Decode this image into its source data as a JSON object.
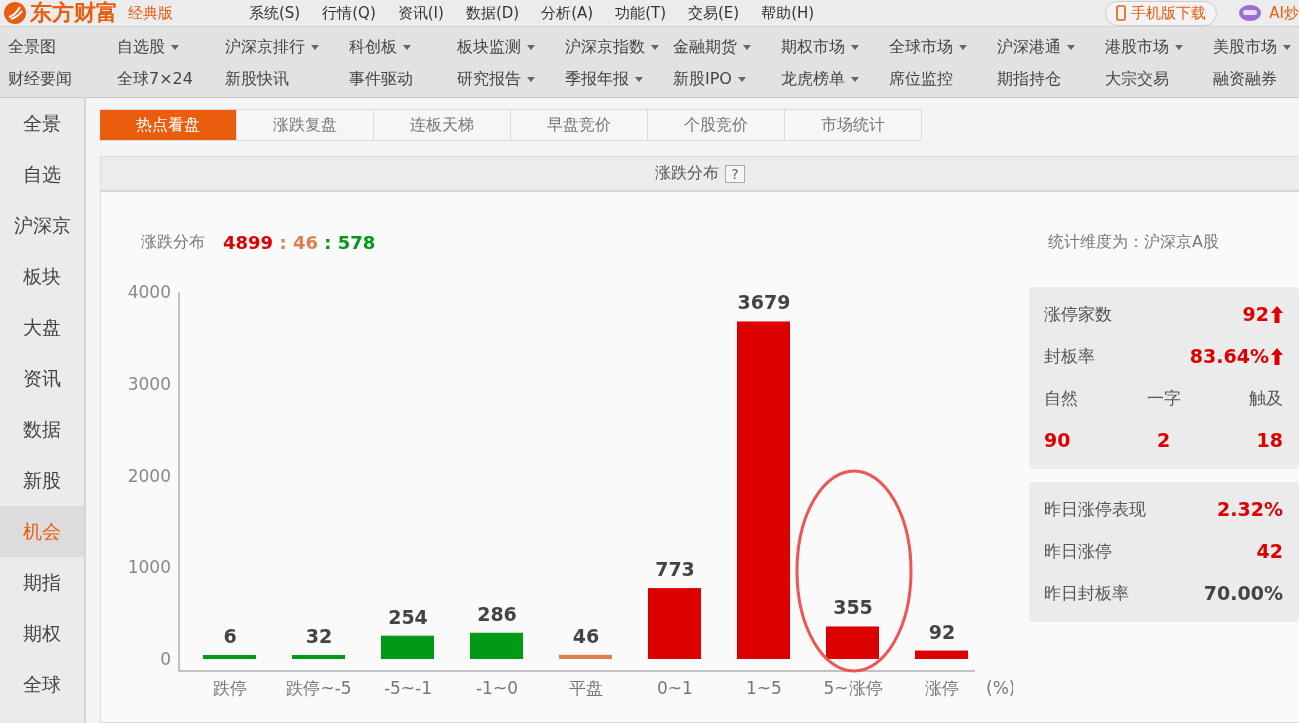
{
  "app_bar": {
    "logo": "东方财富",
    "edition": "经典版",
    "menu": [
      "系统(S)",
      "行情(Q)",
      "资讯(I)",
      "数据(D)",
      "分析(A)",
      "功能(T)",
      "交易(E)",
      "帮助(H)"
    ],
    "mobile_button": "手机版下载",
    "ai_link": "AI炒"
  },
  "nav_rows": [
    [
      {
        "label": "全景图",
        "dropdown": false
      },
      {
        "label": "自选股",
        "dropdown": true
      },
      {
        "label": "沪深京排行",
        "dropdown": true
      },
      {
        "label": "科创板",
        "dropdown": true
      },
      {
        "label": "板块监测",
        "dropdown": true
      },
      {
        "label": "沪深京指数",
        "dropdown": true
      },
      {
        "label": "金融期货",
        "dropdown": true
      },
      {
        "label": "期权市场",
        "dropdown": true
      },
      {
        "label": "全球市场",
        "dropdown": true
      },
      {
        "label": "沪深港通",
        "dropdown": true
      },
      {
        "label": "港股市场",
        "dropdown": true
      },
      {
        "label": "美股市场",
        "dropdown": true
      }
    ],
    [
      {
        "label": "财经要闻",
        "dropdown": false
      },
      {
        "label": "全球7×24",
        "dropdown": false
      },
      {
        "label": "新股快讯",
        "dropdown": false
      },
      {
        "label": "事件驱动",
        "dropdown": false
      },
      {
        "label": "研究报告",
        "dropdown": true
      },
      {
        "label": "季报年报",
        "dropdown": true
      },
      {
        "label": "新股IPO",
        "dropdown": true
      },
      {
        "label": "龙虎榜单",
        "dropdown": true
      },
      {
        "label": "席位监控",
        "dropdown": false
      },
      {
        "label": "期指持仓",
        "dropdown": false
      },
      {
        "label": "大宗交易",
        "dropdown": false
      },
      {
        "label": "融资融券",
        "dropdown": false
      }
    ]
  ],
  "sidebar": {
    "items": [
      {
        "label": "全景",
        "selected": false
      },
      {
        "label": "自选",
        "selected": false
      },
      {
        "label": "沪深京",
        "selected": false
      },
      {
        "label": "板块",
        "selected": false
      },
      {
        "label": "大盘",
        "selected": false
      },
      {
        "label": "资讯",
        "selected": false
      },
      {
        "label": "数据",
        "selected": false
      },
      {
        "label": "新股",
        "selected": false
      },
      {
        "label": "机会",
        "selected": true
      },
      {
        "label": "期指",
        "selected": false
      },
      {
        "label": "期权",
        "selected": false
      },
      {
        "label": "全球",
        "selected": false
      }
    ]
  },
  "tabs": [
    {
      "label": "热点看盘",
      "selected": true
    },
    {
      "label": "涨跌复盘",
      "selected": false
    },
    {
      "label": "连板天梯",
      "selected": false
    },
    {
      "label": "早盘竞价",
      "selected": false
    },
    {
      "label": "个股竞价",
      "selected": false
    },
    {
      "label": "市场统计",
      "selected": false
    }
  ],
  "panel": {
    "title": "涨跌分布",
    "help": "?",
    "summary": {
      "label": "涨跌分布",
      "counts": [
        {
          "value": "4899",
          "color": "#dd0000"
        },
        {
          "value": "46",
          "color": "#d9834a"
        },
        {
          "value": "578",
          "color": "#009a17"
        }
      ],
      "separator": ":"
    },
    "scope": "统计维度为：沪深京A股",
    "chart_data": {
      "type": "bar",
      "categories": [
        "跌停",
        "跌停~-5",
        "-5~-1",
        "-1~0",
        "平盘",
        "0~1",
        "1~5",
        "5~涨停",
        "涨停"
      ],
      "xlabel": "(%)",
      "ylim": [
        0,
        4000
      ],
      "yticks": [
        0,
        1000,
        2000,
        3000,
        4000
      ],
      "data_labels": true,
      "series": [
        {
          "values": [
            6,
            32,
            254,
            286,
            46,
            773,
            3679,
            355,
            92
          ]
        }
      ],
      "colors": [
        "#009a17",
        "#009a17",
        "#009a17",
        "#009a17",
        "#d9834a",
        "#dd0000",
        "#dd0000",
        "#dd0000",
        "#dd0000"
      ]
    },
    "highlight": {
      "circled": [
        false,
        false,
        false,
        false,
        false,
        false,
        false,
        true,
        false
      ],
      "color": "#ee5555"
    },
    "limit_up_card": {
      "rows": [
        {
          "label": "涨停家数",
          "value": "92",
          "rising": true
        },
        {
          "label": "封板率",
          "value": "83.64%",
          "rising": true
        }
      ],
      "split_labels": [
        "自然",
        "一字",
        "触及"
      ],
      "split_values": [
        "90",
        "2",
        "18"
      ]
    },
    "yesterday_card": {
      "rows": [
        {
          "label": "昨日涨停表现",
          "value": "2.32%",
          "color": "#dd0000"
        },
        {
          "label": "昨日涨停",
          "value": "42",
          "color": "#dd0000"
        },
        {
          "label": "昨日封板率",
          "value": "70.00%",
          "color": "#444444"
        }
      ]
    }
  }
}
